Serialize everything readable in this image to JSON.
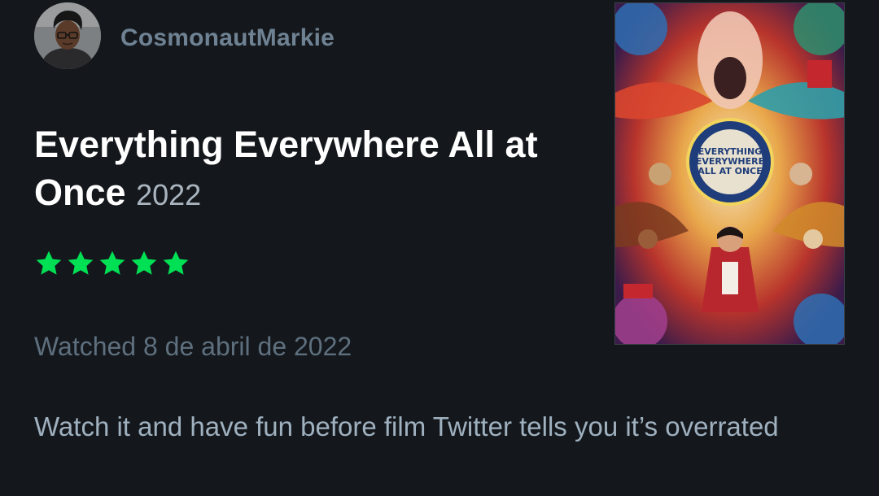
{
  "user": {
    "username": "CosmonautMarkie",
    "avatar_icon": "user-avatar-photo"
  },
  "film": {
    "title": "Everything Everywhere All at Once",
    "year": "2022",
    "poster_text": [
      "EVERYTHING",
      "EVERYWHERE",
      "ALL AT ONCE"
    ]
  },
  "rating": {
    "stars": 5,
    "max": 5,
    "star_icon": "star-icon",
    "color": "#00e054"
  },
  "watched": "Watched 8 de abril de 2022",
  "review": "Watch it and have fun before film Twitter tells you it’s overrated",
  "colors": {
    "background": "#14181c",
    "username": "#6f8293",
    "title": "#ffffff",
    "year": "#aab4be",
    "watched": "#5e6f7e",
    "review": "#9fb0bf",
    "star": "#00e054"
  }
}
